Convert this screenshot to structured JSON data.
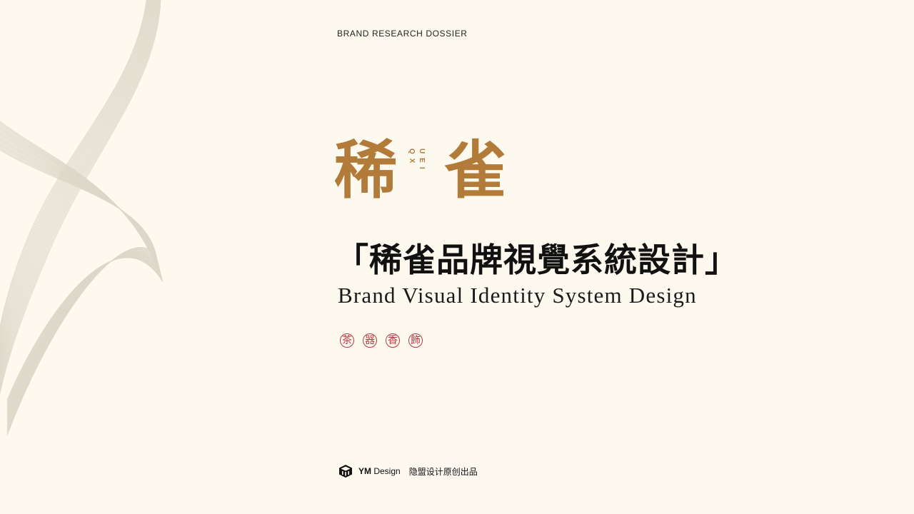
{
  "header": {
    "label": "BRAND RESEARCH DOSSIER"
  },
  "logo": {
    "char_1": "稀",
    "char_2": "雀",
    "roman_1": "QX",
    "roman_2": "UEI"
  },
  "title": {
    "chinese": "「稀雀品牌視覺系統設計」",
    "english": "Brand Visual Identity System Design"
  },
  "tags": [
    "茶",
    "器",
    "香",
    "飾"
  ],
  "footer": {
    "brand_bold": "YM",
    "brand_rest": " Design",
    "subtitle": "隐盟设计原创出品"
  },
  "colors": {
    "background": "#fdf9ef",
    "logo_gold": "#b27b3a",
    "seal_red": "#b53a46",
    "text": "#111111"
  }
}
